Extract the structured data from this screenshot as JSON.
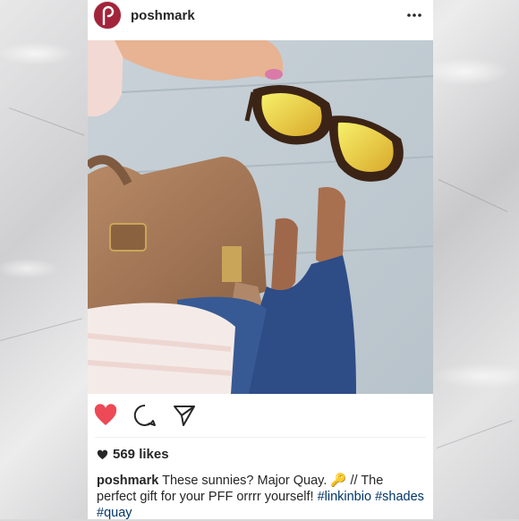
{
  "post": {
    "username": "poshmark",
    "likes": "569 likes",
    "caption": {
      "username": "poshmark",
      "text": "These sunnies? Major Quay. 🔑 // The perfect gift for your PFF orrrr yourself!",
      "hashtags": [
        "#linkinbio",
        "#shades",
        "#quay"
      ]
    }
  },
  "icons": {
    "avatar": "poshmark-logo",
    "more": "more-dots-icon",
    "like": "heart-icon",
    "comment": "comment-icon",
    "share": "share-icon",
    "likes": "heart-small-icon"
  },
  "colors": {
    "like": "#ed4956",
    "brand": "#a2243a",
    "hashtag": "#003569",
    "text": "#262626"
  }
}
